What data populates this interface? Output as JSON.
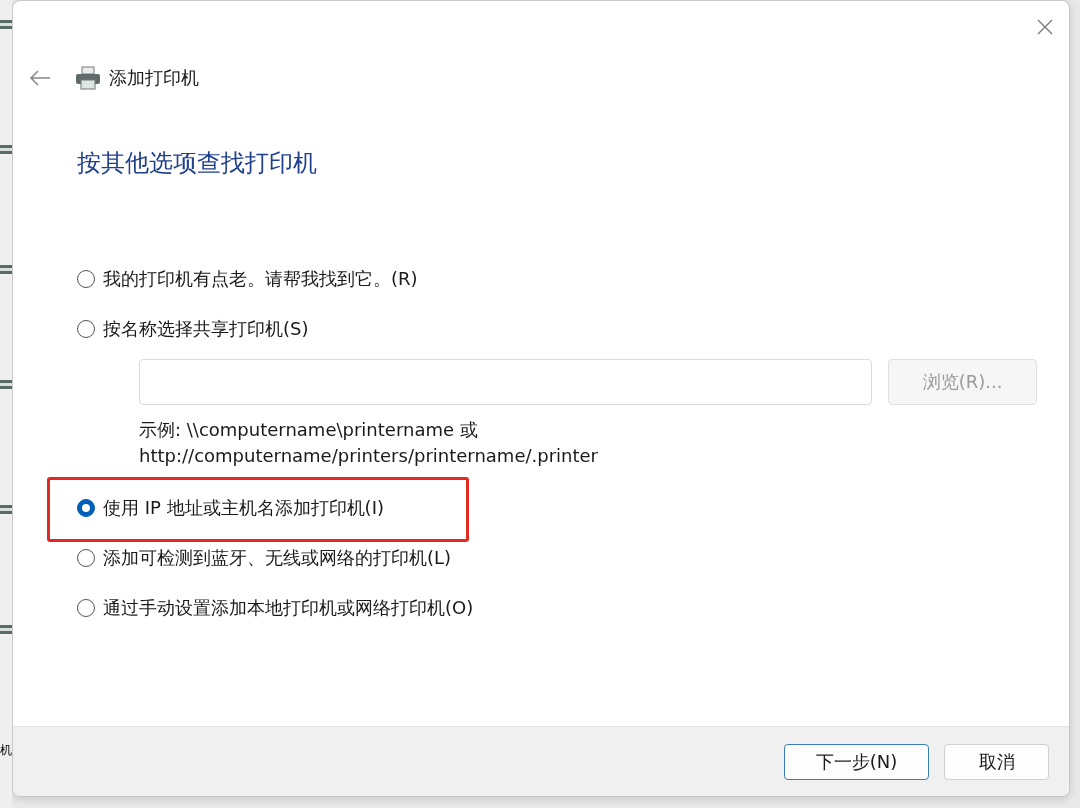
{
  "background_window": {
    "text": "机"
  },
  "dialog": {
    "title": "添加打印机",
    "heading": "按其他选项查找打印机",
    "options": [
      {
        "label": "我的打印机有点老。请帮我找到它。(R)",
        "kind": "plain",
        "selected": false,
        "highlighted": false
      },
      {
        "label": "按名称选择共享打印机(S)",
        "kind": "with_path",
        "selected": false,
        "highlighted": false
      },
      {
        "label": "使用 IP 地址或主机名添加打印机(I)",
        "kind": "plain",
        "selected": true,
        "highlighted": true
      },
      {
        "label": "添加可检测到蓝牙、无线或网络的打印机(L)",
        "kind": "plain",
        "selected": false,
        "highlighted": false
      },
      {
        "label": "通过手动设置添加本地打印机或网络打印机(O)",
        "kind": "plain",
        "selected": false,
        "highlighted": false
      }
    ],
    "share_name": {
      "browse_button": {
        "label": "浏览(R)...",
        "disabled": true
      },
      "example_lines": [
        "示例: \\\\computername\\printername 或",
        "http://computername/printers/printername/.printer"
      ]
    },
    "buttons": [
      {
        "label": "下一步(N)",
        "kind": "default"
      },
      {
        "label": "取消",
        "kind": "normal"
      }
    ]
  }
}
